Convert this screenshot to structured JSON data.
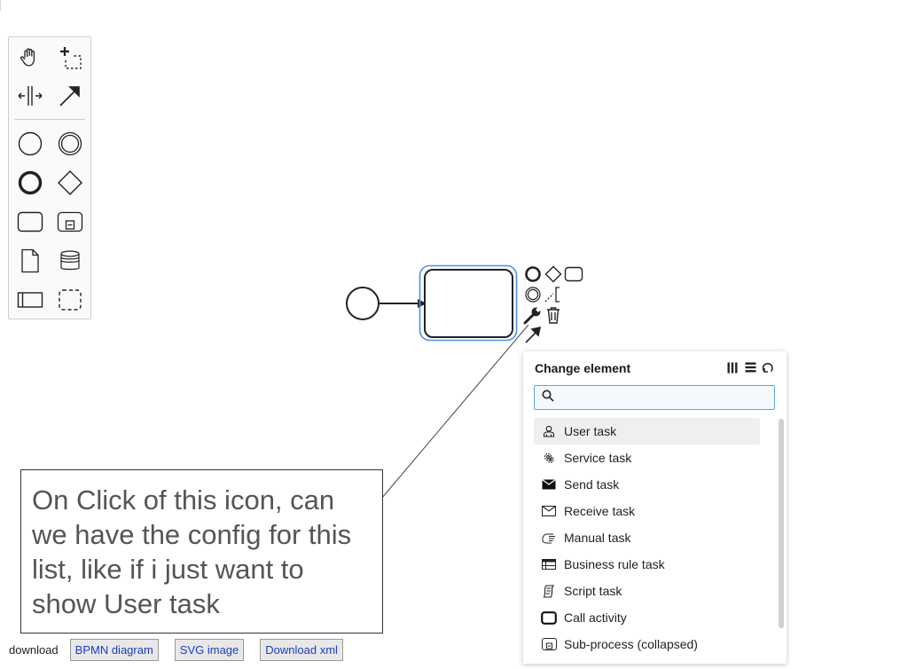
{
  "palette": {
    "tools": [
      {
        "name": "hand-tool-icon"
      },
      {
        "name": "lasso-tool-icon"
      },
      {
        "name": "space-tool-icon"
      },
      {
        "name": "connect-tool-icon"
      },
      {
        "name": "start-event-icon"
      },
      {
        "name": "intermediate-event-icon"
      },
      {
        "name": "end-event-icon"
      },
      {
        "name": "gateway-icon"
      },
      {
        "name": "task-icon"
      },
      {
        "name": "subprocess-icon"
      },
      {
        "name": "data-object-icon"
      },
      {
        "name": "data-store-icon"
      },
      {
        "name": "pool-icon"
      },
      {
        "name": "group-icon"
      }
    ]
  },
  "colors": {
    "selection": "#4a90e2",
    "search_border": "#58a9e0",
    "link": "#1b3cc4"
  },
  "popup": {
    "title": "Change element",
    "search_value": "",
    "search_placeholder": "",
    "entries": [
      {
        "label": "User task",
        "icon": "user-task-icon",
        "active": true
      },
      {
        "label": "Service task",
        "icon": "service-task-icon"
      },
      {
        "label": "Send task",
        "icon": "send-task-icon"
      },
      {
        "label": "Receive task",
        "icon": "receive-task-icon"
      },
      {
        "label": "Manual task",
        "icon": "manual-task-icon"
      },
      {
        "label": "Business rule task",
        "icon": "business-rule-task-icon"
      },
      {
        "label": "Script task",
        "icon": "script-task-icon"
      },
      {
        "label": "Call activity",
        "icon": "call-activity-icon"
      },
      {
        "label": "Sub-process (collapsed)",
        "icon": "subprocess-collapsed-icon"
      }
    ]
  },
  "annotation": {
    "lines": [
      "On Click of this icon, can",
      "we have the config for this",
      "list, like if i just want to",
      "show User task"
    ]
  },
  "download": {
    "label": "download",
    "buttons": [
      "BPMN diagram",
      "SVG image",
      "Download xml"
    ]
  }
}
